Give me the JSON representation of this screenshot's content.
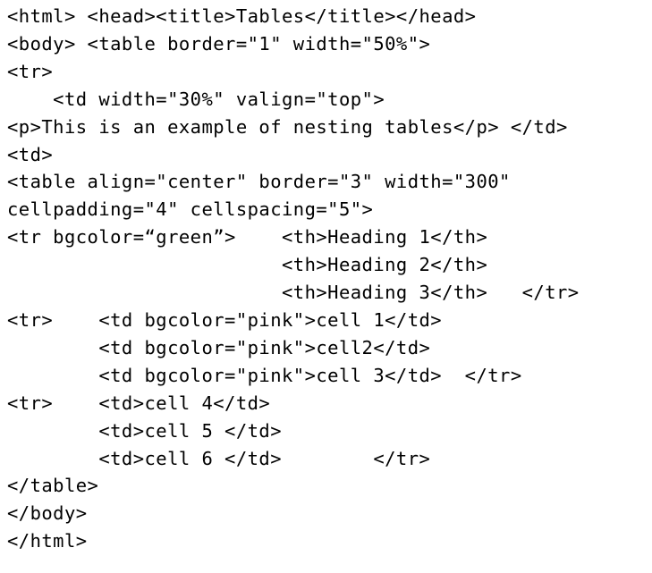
{
  "code": {
    "lines": [
      "<html> <head><title>Tables</title></head>",
      "<body> <table border=\"1\" width=\"50%\">",
      "<tr>",
      "    <td width=\"30%\" valign=\"top\">",
      "<p>This is an example of nesting tables</p> </td>",
      "<td>",
      "<table align=\"center\" border=\"3\" width=\"300\"",
      "cellpadding=\"4\" cellspacing=\"5\">",
      "<tr bgcolor=“green”>    <th>Heading 1</th>",
      "                        <th>Heading 2</th>",
      "                        <th>Heading 3</th>   </tr>",
      "<tr>    <td bgcolor=\"pink\">cell 1</td>",
      "        <td bgcolor=\"pink\">cell2</td>",
      "        <td bgcolor=\"pink\">cell 3</td>  </tr>",
      "<tr>    <td>cell 4</td>",
      "        <td>cell 5 </td>",
      "        <td>cell 6 </td>        </tr>",
      "</table>",
      "</body>",
      "</html>"
    ]
  }
}
